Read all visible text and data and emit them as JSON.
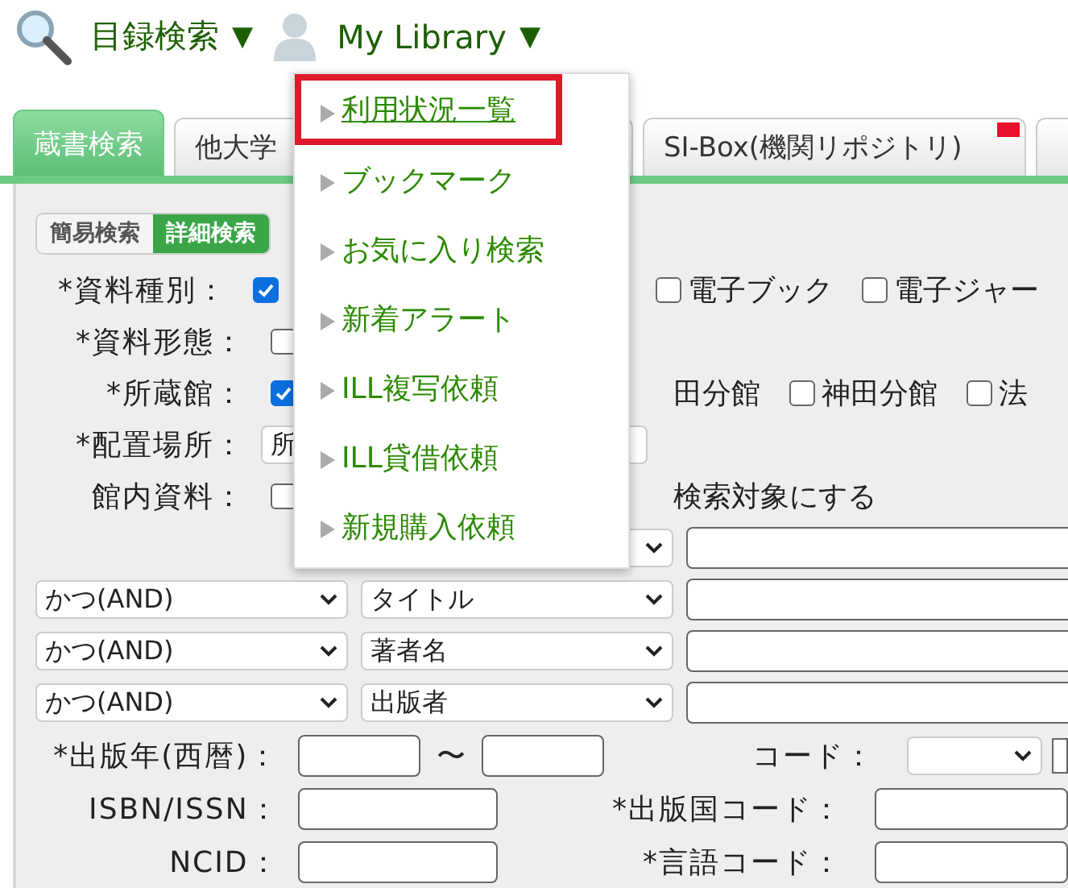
{
  "header": {
    "catalog_menu": "目録検索",
    "catalog_caret": "▼",
    "library_menu": "My Library",
    "library_caret": "▼"
  },
  "tabs": [
    {
      "label": "蔵書検索",
      "selected": true,
      "flagged": false
    },
    {
      "label": "他大学",
      "selected": false,
      "flagged": false
    },
    {
      "label": "SI-Box(機関リポジトリ)",
      "selected": false,
      "flagged": true
    },
    {
      "selected": false,
      "flagged": false
    }
  ],
  "mode_tabs": [
    {
      "label": "簡易検索",
      "selected": false
    },
    {
      "label": "詳細検索",
      "selected": true
    }
  ],
  "filters": [
    {
      "kind": "checkboxes",
      "label": "*資料種別：",
      "options": [
        {
          "checked": true
        },
        {
          "label": "電子ブック",
          "checked": false
        },
        {
          "label": "電子ジャー",
          "checked": false
        }
      ]
    },
    {
      "kind": "checkboxes",
      "label": "*資料形態：",
      "options": [
        {
          "checked": false
        }
      ]
    },
    {
      "kind": "checkboxes",
      "label": "*所蔵館：",
      "options": [
        {
          "checked": true
        },
        {
          "label": "田分館"
        },
        {
          "label": "神田分館",
          "checked": false
        },
        {
          "label": "法",
          "checked": false
        }
      ]
    },
    {
      "kind": "select",
      "label": "*配置場所：",
      "value": "所"
    },
    {
      "kind": "checkboxes",
      "label": "館内資料：",
      "options": [
        {
          "checked": false
        },
        {
          "label": "検索対象にする"
        }
      ]
    }
  ],
  "search_rows": [
    {
      "kind": "first"
    },
    {
      "kind": "joined",
      "operator": "かつ(AND)",
      "field": "タイトル"
    },
    {
      "kind": "joined",
      "operator": "かつ(AND)",
      "field": "著者名"
    },
    {
      "kind": "joined",
      "operator": "かつ(AND)",
      "field": "出版者"
    }
  ],
  "detail_rows": [
    {
      "label": "*出版年(西暦)：",
      "kind": "range",
      "separator": "〜",
      "right": {
        "label": "コード：",
        "kind": "select"
      }
    },
    {
      "label": "ISBN/ISSN：",
      "kind": "text",
      "right": {
        "label": "*出版国コード：",
        "kind": "text"
      }
    },
    {
      "label": "NCID：",
      "kind": "text",
      "right": {
        "label": "*言語コード：",
        "kind": "text"
      }
    }
  ],
  "library_menu_items": [
    {
      "label": "利用状況一覧",
      "selected": true
    },
    {
      "label": "ブックマーク",
      "selected": false
    },
    {
      "label": "お気に入り検索",
      "selected": false
    },
    {
      "label": "新着アラート",
      "selected": false
    },
    {
      "label": "ILL複写依頼",
      "selected": false
    },
    {
      "label": "ILL貸借依頼",
      "selected": false
    },
    {
      "label": "新規購入依頼",
      "selected": false
    }
  ]
}
